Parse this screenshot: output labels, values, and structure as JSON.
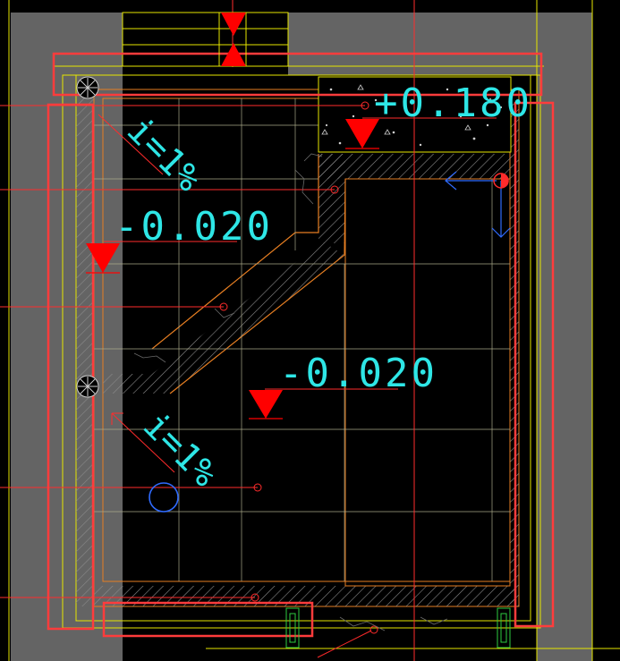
{
  "drawing": {
    "background_color": "#000000",
    "colors": {
      "wall_fill": "#646464",
      "outline_yellow": "#e6e600",
      "red_markup": "#ff2b2b",
      "red_marker": "#ff0000",
      "text_cyan": "#2ee6e6",
      "grid_line": "#c8c8a0",
      "orange_line": "#e67e22",
      "blue_circle": "#2f6bff"
    },
    "annotations": {
      "elevation_main": "-0.020",
      "elevation_left": "-0.020",
      "elevation_top_right": "+0.180",
      "slope_upper": "i=1%",
      "slope_lower": "i=1%"
    },
    "icons": [
      "floor-drain-icon",
      "floor-drain-icon",
      "elevation-marker-icon",
      "door-swing-icon"
    ]
  }
}
